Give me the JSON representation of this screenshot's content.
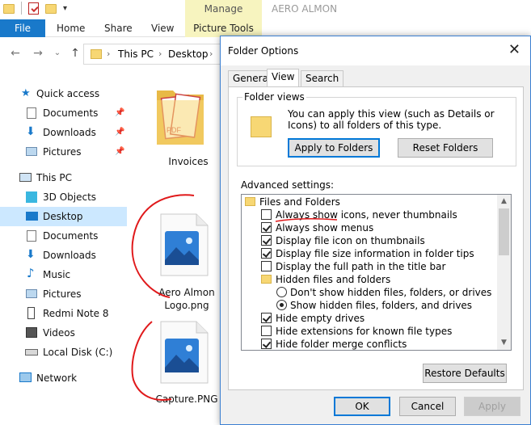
{
  "window": {
    "title": "AERO ALMON",
    "manage_label": "Manage"
  },
  "ribbon": {
    "tabs": [
      "File",
      "Home",
      "Share",
      "View",
      "Picture Tools"
    ]
  },
  "address": {
    "crumbs": [
      "This PC",
      "Desktop"
    ]
  },
  "nav": {
    "quick_access": "Quick access",
    "quick_items": [
      "Documents",
      "Downloads",
      "Pictures"
    ],
    "this_pc": "This PC",
    "pc_items": [
      "3D Objects",
      "Desktop",
      "Documents",
      "Downloads",
      "Music",
      "Pictures",
      "Redmi Note 8",
      "Videos",
      "Local Disk (C:)"
    ],
    "network": "Network"
  },
  "files": [
    {
      "name": "Invoices"
    },
    {
      "name_line1": "Aero Almon",
      "name_line2": "Logo.png"
    },
    {
      "name": "Capture.PNG"
    }
  ],
  "dialog": {
    "title": "Folder Options",
    "tabs": [
      "General",
      "View",
      "Search"
    ],
    "folder_views": {
      "legend": "Folder views",
      "description": "You can apply this view (such as Details or Icons) to all folders of this type.",
      "apply_label": "Apply to Folders",
      "reset_label": "Reset Folders"
    },
    "advanced_label": "Advanced settings:",
    "settings": [
      {
        "type": "folder",
        "label": "Files and Folders"
      },
      {
        "type": "check",
        "checked": false,
        "label": "Always show icons, never thumbnails"
      },
      {
        "type": "check",
        "checked": true,
        "label": "Always show menus"
      },
      {
        "type": "check",
        "checked": true,
        "label": "Display file icon on thumbnails"
      },
      {
        "type": "check",
        "checked": true,
        "label": "Display file size information in folder tips"
      },
      {
        "type": "check",
        "checked": false,
        "label": "Display the full path in the title bar"
      },
      {
        "type": "folder",
        "label": "Hidden files and folders"
      },
      {
        "type": "radio",
        "checked": false,
        "label": "Don't show hidden files, folders, or drives"
      },
      {
        "type": "radio",
        "checked": true,
        "label": "Show hidden files, folders, and drives"
      },
      {
        "type": "check",
        "checked": true,
        "label": "Hide empty drives"
      },
      {
        "type": "check",
        "checked": false,
        "label": "Hide extensions for known file types"
      },
      {
        "type": "check",
        "checked": true,
        "label": "Hide folder merge conflicts"
      }
    ],
    "restore_label": "Restore Defaults",
    "ok_label": "OK",
    "cancel_label": "Cancel",
    "apply_label": "Apply"
  },
  "colors": {
    "accent": "#1979ca",
    "annotation": "#e0191b",
    "selection": "#cce8ff"
  }
}
